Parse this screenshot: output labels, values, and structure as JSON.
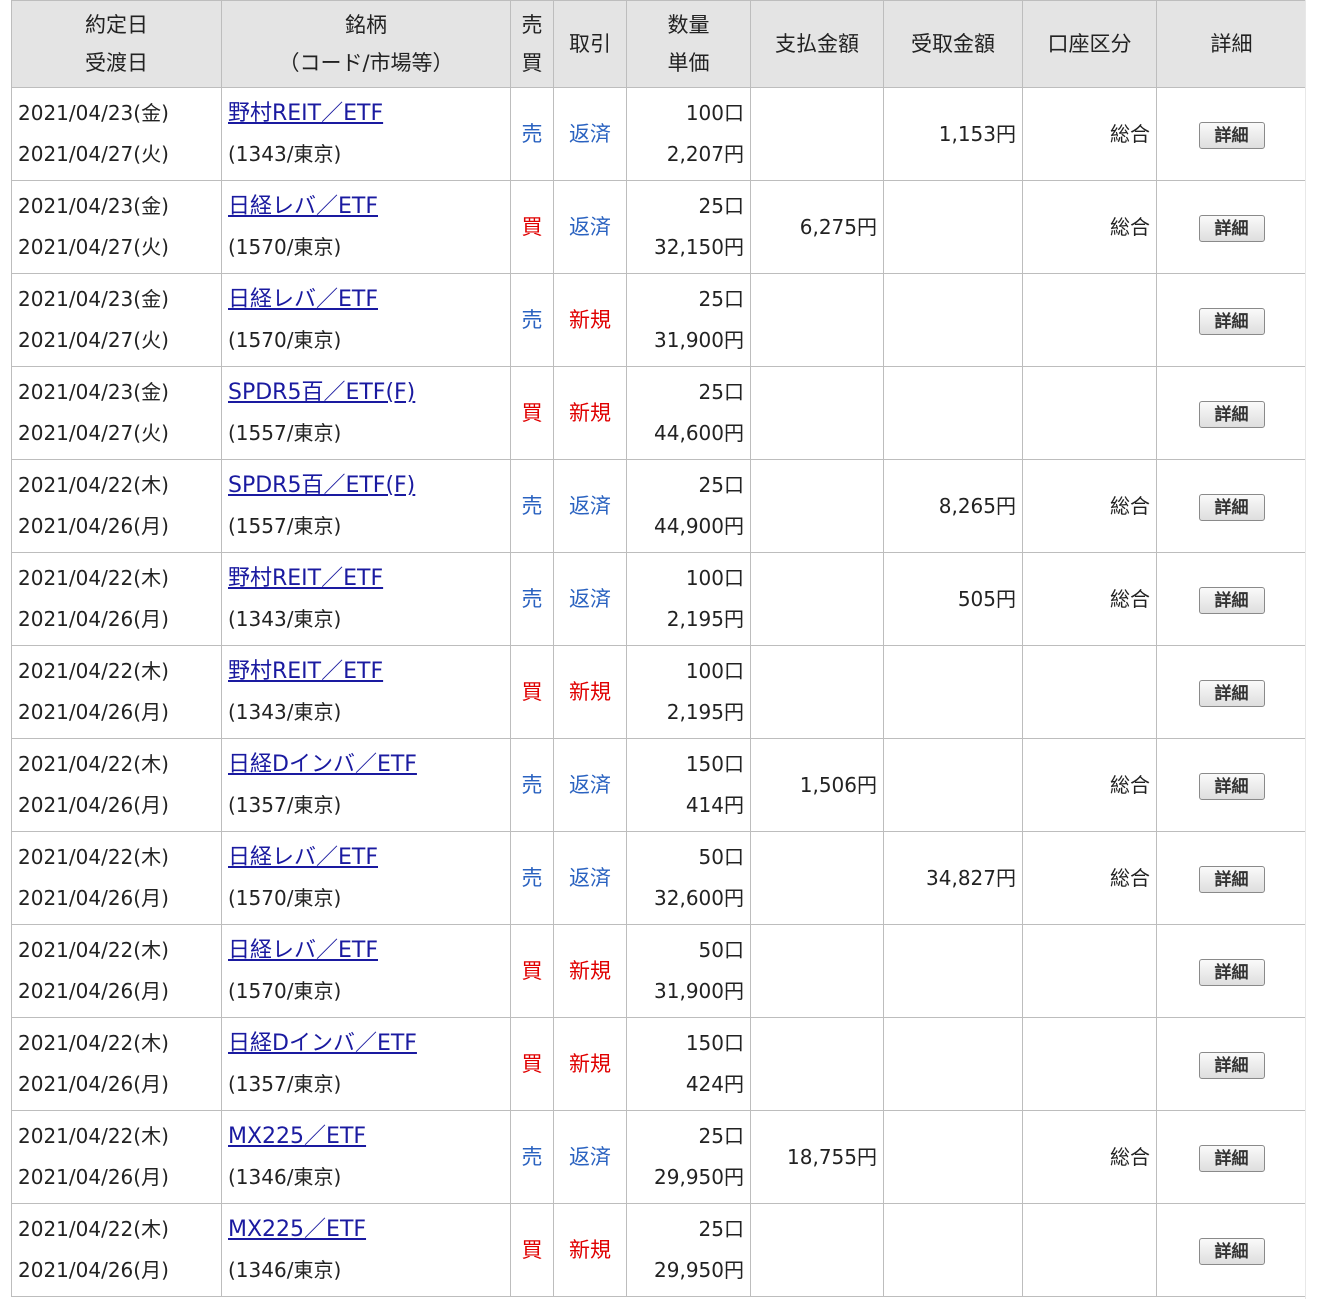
{
  "header": {
    "date1": "約定日",
    "date2": "受渡日",
    "name1": "銘柄",
    "name2": "（コード/市場等）",
    "side1": "売",
    "side2": "買",
    "trade": "取引",
    "qty1": "数量",
    "qty2": "単価",
    "pay": "支払金額",
    "recv": "受取金額",
    "account": "口座区分",
    "detail": "詳細"
  },
  "detail_button_label": "詳細",
  "rows": [
    {
      "d1": "2021/04/23(金)",
      "d2": "2021/04/27(火)",
      "name": "野村REIT／ETF",
      "code": "(1343/東京)",
      "side": "売",
      "trade": "返済",
      "qty": "100口",
      "price": "2,207円",
      "pay": "",
      "recv": "1,153円",
      "account": "総合"
    },
    {
      "d1": "2021/04/23(金)",
      "d2": "2021/04/27(火)",
      "name": "日経レバ／ETF",
      "code": "(1570/東京)",
      "side": "買",
      "trade": "返済",
      "qty": "25口",
      "price": "32,150円",
      "pay": "6,275円",
      "recv": "",
      "account": "総合"
    },
    {
      "d1": "2021/04/23(金)",
      "d2": "2021/04/27(火)",
      "name": "日経レバ／ETF",
      "code": "(1570/東京)",
      "side": "売",
      "trade": "新規",
      "qty": "25口",
      "price": "31,900円",
      "pay": "",
      "recv": "",
      "account": ""
    },
    {
      "d1": "2021/04/23(金)",
      "d2": "2021/04/27(火)",
      "name": "SPDR5百／ETF(F)",
      "code": "(1557/東京)",
      "side": "買",
      "trade": "新規",
      "qty": "25口",
      "price": "44,600円",
      "pay": "",
      "recv": "",
      "account": ""
    },
    {
      "d1": "2021/04/22(木)",
      "d2": "2021/04/26(月)",
      "name": "SPDR5百／ETF(F)",
      "code": "(1557/東京)",
      "side": "売",
      "trade": "返済",
      "qty": "25口",
      "price": "44,900円",
      "pay": "",
      "recv": "8,265円",
      "account": "総合"
    },
    {
      "d1": "2021/04/22(木)",
      "d2": "2021/04/26(月)",
      "name": "野村REIT／ETF",
      "code": "(1343/東京)",
      "side": "売",
      "trade": "返済",
      "qty": "100口",
      "price": "2,195円",
      "pay": "",
      "recv": "505円",
      "account": "総合"
    },
    {
      "d1": "2021/04/22(木)",
      "d2": "2021/04/26(月)",
      "name": "野村REIT／ETF",
      "code": "(1343/東京)",
      "side": "買",
      "trade": "新規",
      "qty": "100口",
      "price": "2,195円",
      "pay": "",
      "recv": "",
      "account": ""
    },
    {
      "d1": "2021/04/22(木)",
      "d2": "2021/04/26(月)",
      "name": "日経Dインバ／ETF",
      "code": "(1357/東京)",
      "side": "売",
      "trade": "返済",
      "qty": "150口",
      "price": "414円",
      "pay": "1,506円",
      "recv": "",
      "account": "総合"
    },
    {
      "d1": "2021/04/22(木)",
      "d2": "2021/04/26(月)",
      "name": "日経レバ／ETF",
      "code": "(1570/東京)",
      "side": "売",
      "trade": "返済",
      "qty": "50口",
      "price": "32,600円",
      "pay": "",
      "recv": "34,827円",
      "account": "総合"
    },
    {
      "d1": "2021/04/22(木)",
      "d2": "2021/04/26(月)",
      "name": "日経レバ／ETF",
      "code": "(1570/東京)",
      "side": "買",
      "trade": "新規",
      "qty": "50口",
      "price": "31,900円",
      "pay": "",
      "recv": "",
      "account": ""
    },
    {
      "d1": "2021/04/22(木)",
      "d2": "2021/04/26(月)",
      "name": "日経Dインバ／ETF",
      "code": "(1357/東京)",
      "side": "買",
      "trade": "新規",
      "qty": "150口",
      "price": "424円",
      "pay": "",
      "recv": "",
      "account": ""
    },
    {
      "d1": "2021/04/22(木)",
      "d2": "2021/04/26(月)",
      "name": "MX225／ETF",
      "code": "(1346/東京)",
      "side": "売",
      "trade": "返済",
      "qty": "25口",
      "price": "29,950円",
      "pay": "18,755円",
      "recv": "",
      "account": "総合"
    },
    {
      "d1": "2021/04/22(木)",
      "d2": "2021/04/26(月)",
      "name": "MX225／ETF",
      "code": "(1346/東京)",
      "side": "買",
      "trade": "新規",
      "qty": "25口",
      "price": "29,950円",
      "pay": "",
      "recv": "",
      "account": ""
    }
  ],
  "colors": {
    "sell": "#2a62c0",
    "buy": "#e00000",
    "new": "#e00000",
    "settle": "#2a62c0",
    "link": "#1a1aa0"
  }
}
